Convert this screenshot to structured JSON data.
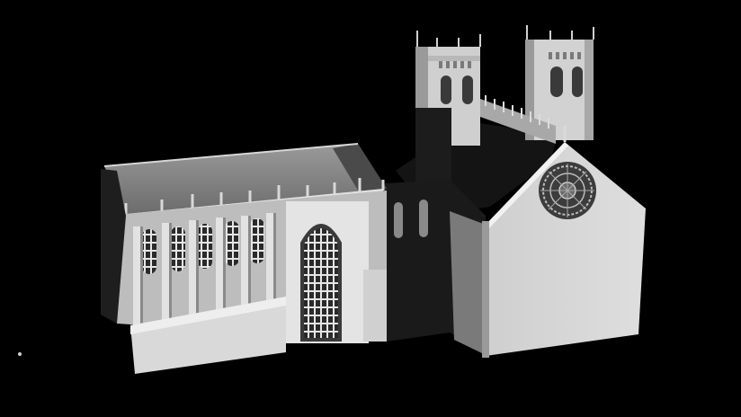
{
  "scene": {
    "subject": "cathedral-3d-model-render",
    "background_color": "#000000",
    "model_base_color": "#d8d8d8",
    "shadow_color": "#3a3a3a",
    "roof_color": "#8a8a8a"
  }
}
